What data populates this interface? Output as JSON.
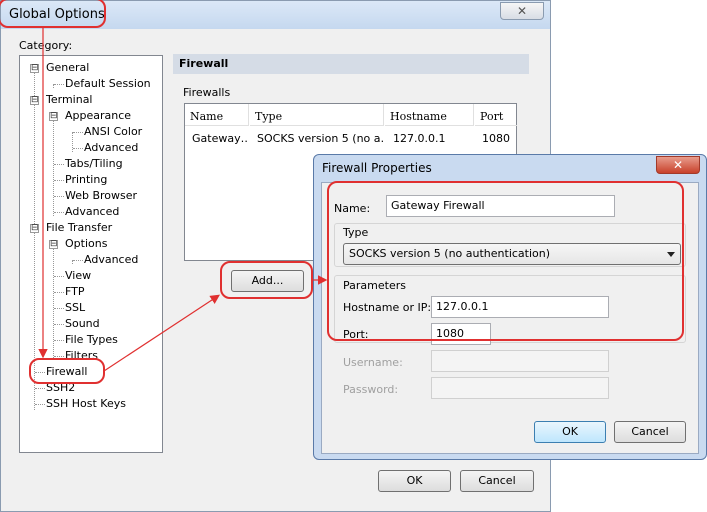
{
  "window": {
    "title": "Global Options",
    "close_glyph": "✕"
  },
  "category_label": "Category:",
  "tree": {
    "items": [
      "General",
      "Default Session",
      "Terminal",
      "Appearance",
      "ANSI Color",
      "Advanced",
      "Tabs/Tiling",
      "Printing",
      "Web Browser",
      "Advanced",
      "File Transfer",
      "Options",
      "Advanced",
      "View",
      "FTP",
      "SSL",
      "Sound",
      "File Types",
      "Filters",
      "Firewall",
      "SSH2",
      "SSH Host Keys"
    ],
    "expander": "⊟"
  },
  "panel": {
    "header": "Firewall",
    "firewalls_label": "Firewalls",
    "columns": [
      "Name",
      "Type",
      "Hostname",
      "Port"
    ],
    "rows": [
      {
        "name": "Gateway…",
        "type": "SOCKS version 5 (no a…",
        "hostname": "127.0.0.1",
        "port": "1080"
      }
    ],
    "add_label": "Add..."
  },
  "footer": {
    "ok_label": "OK",
    "cancel_label": "Cancel"
  },
  "dialog": {
    "title": "Firewall Properties",
    "close_glyph": "✕",
    "name_label": "Name:",
    "name_value": "Gateway Firewall",
    "type_group": "Type",
    "type_value": "SOCKS version 5 (no authentication)",
    "params_group": "Parameters",
    "hostname_label": "Hostname or IP:",
    "hostname_value": "127.0.0.1",
    "port_label": "Port:",
    "port_value": "1080",
    "username_label": "Username:",
    "password_label": "Password:",
    "ok_label": "OK",
    "cancel_label": "Cancel"
  },
  "colors": {
    "annotation_red": "#e03030",
    "accent_blue": "#3c7fb1"
  }
}
